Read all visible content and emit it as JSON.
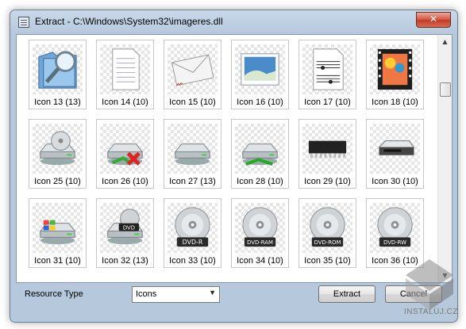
{
  "window": {
    "title": "Extract - C:\\Windows\\System32\\imageres.dll",
    "close_label": "✕"
  },
  "icons": [
    {
      "label": "Icon 13 (13)",
      "icon": "folder-search-icon"
    },
    {
      "label": "Icon 14 (10)",
      "icon": "document-icon"
    },
    {
      "label": "Icon 15 (10)",
      "icon": "envelope-icon"
    },
    {
      "label": "Icon 16 (10)",
      "icon": "picture-icon"
    },
    {
      "label": "Icon 17 (10)",
      "icon": "sheet-music-icon"
    },
    {
      "label": "Icon 18 (10)",
      "icon": "video-film-icon"
    },
    {
      "label": "Icon 25 (10)",
      "icon": "cd-drive-icon"
    },
    {
      "label": "Icon 26 (10)",
      "icon": "network-drive-disconnected-icon"
    },
    {
      "label": "Icon 27 (13)",
      "icon": "hard-drive-icon"
    },
    {
      "label": "Icon 28 (10)",
      "icon": "network-drive-icon"
    },
    {
      "label": "Icon 29 (10)",
      "icon": "memory-chip-icon"
    },
    {
      "label": "Icon 30 (10)",
      "icon": "removable-drive-icon"
    },
    {
      "label": "Icon 31 (10)",
      "icon": "windows-drive-icon"
    },
    {
      "label": "Icon 32 (13)",
      "icon": "dvd-drive-icon"
    },
    {
      "label": "Icon 33 (10)",
      "icon": "dvd-r-disc-icon",
      "disc_text": "DVD-R"
    },
    {
      "label": "Icon 34 (10)",
      "icon": "dvd-ram-disc-icon",
      "disc_text": "DVD-RAM"
    },
    {
      "label": "Icon 35 (10)",
      "icon": "dvd-rom-disc-icon",
      "disc_text": "DVD-ROM"
    },
    {
      "label": "Icon 36 (10)",
      "icon": "dvd-rw-disc-icon",
      "disc_text": "DVD-RW"
    }
  ],
  "dvd_badge": "DVD",
  "footer": {
    "resource_type_label": "Resource Type",
    "resource_type_value": "Icons",
    "extract_label": "Extract",
    "cancel_label": "Cancel"
  },
  "watermark": {
    "text": "INSTALUJ.CZ"
  },
  "colors": {
    "accent": "#b5c8dc",
    "close": "#c13a25"
  }
}
